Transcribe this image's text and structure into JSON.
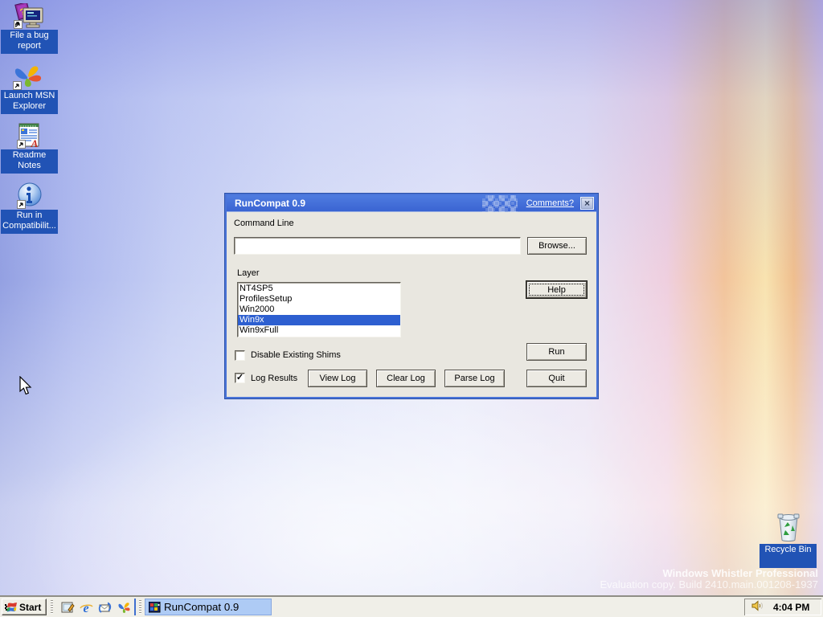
{
  "desktop": {
    "icons": [
      {
        "name": "file-a-bug-report",
        "line1": "File a bug",
        "line2": "report"
      },
      {
        "name": "launch-msn-explorer",
        "line1": "Launch MSN",
        "line2": "Explorer"
      },
      {
        "name": "readme-notes",
        "line1": "Readme Notes",
        "line2": ""
      },
      {
        "name": "run-in-compatibility",
        "line1": "Run in",
        "line2": "Compatibilit..."
      }
    ],
    "recycle_bin_label": "Recycle Bin",
    "watermark_line1": "Windows Whistler Professional",
    "watermark_line2": "Evaluation copy. Build 2410.main.001208-1937",
    "label_bg": "#2153B5"
  },
  "dialog": {
    "title": "RunCompat 0.9",
    "comments_link": "Comments?",
    "close_glyph": "×",
    "command_line_label": "Command Line",
    "command_line_value": "",
    "browse_button": "Browse...",
    "layer_label": "Layer",
    "layer_options": [
      "NT4SP5",
      "ProfilesSetup",
      "Win2000",
      "Win9x",
      "Win9xFull"
    ],
    "layer_selected": "Win9x",
    "help_button": "Help",
    "disable_shims_label": "Disable Existing Shims",
    "disable_shims_checked": false,
    "disable_shims_glyph": "",
    "log_results_label": "Log Results",
    "log_results_checked": true,
    "log_results_glyph": "✓",
    "view_log_button": "View Log",
    "clear_log_button": "Clear Log",
    "parse_log_button": "Parse Log",
    "run_button": "Run",
    "quit_button": "Quit",
    "title_bar_color": "#3D6AD6",
    "selection_color": "#2D5FD0"
  },
  "taskbar": {
    "start_label": "Start",
    "quick_launch_icons": [
      "show-desktop-icon",
      "internet-explorer-icon",
      "outlook-express-icon",
      "msn-icon"
    ],
    "task_button_label": "RunCompat 0.9",
    "tray_time": "4:04 PM"
  }
}
